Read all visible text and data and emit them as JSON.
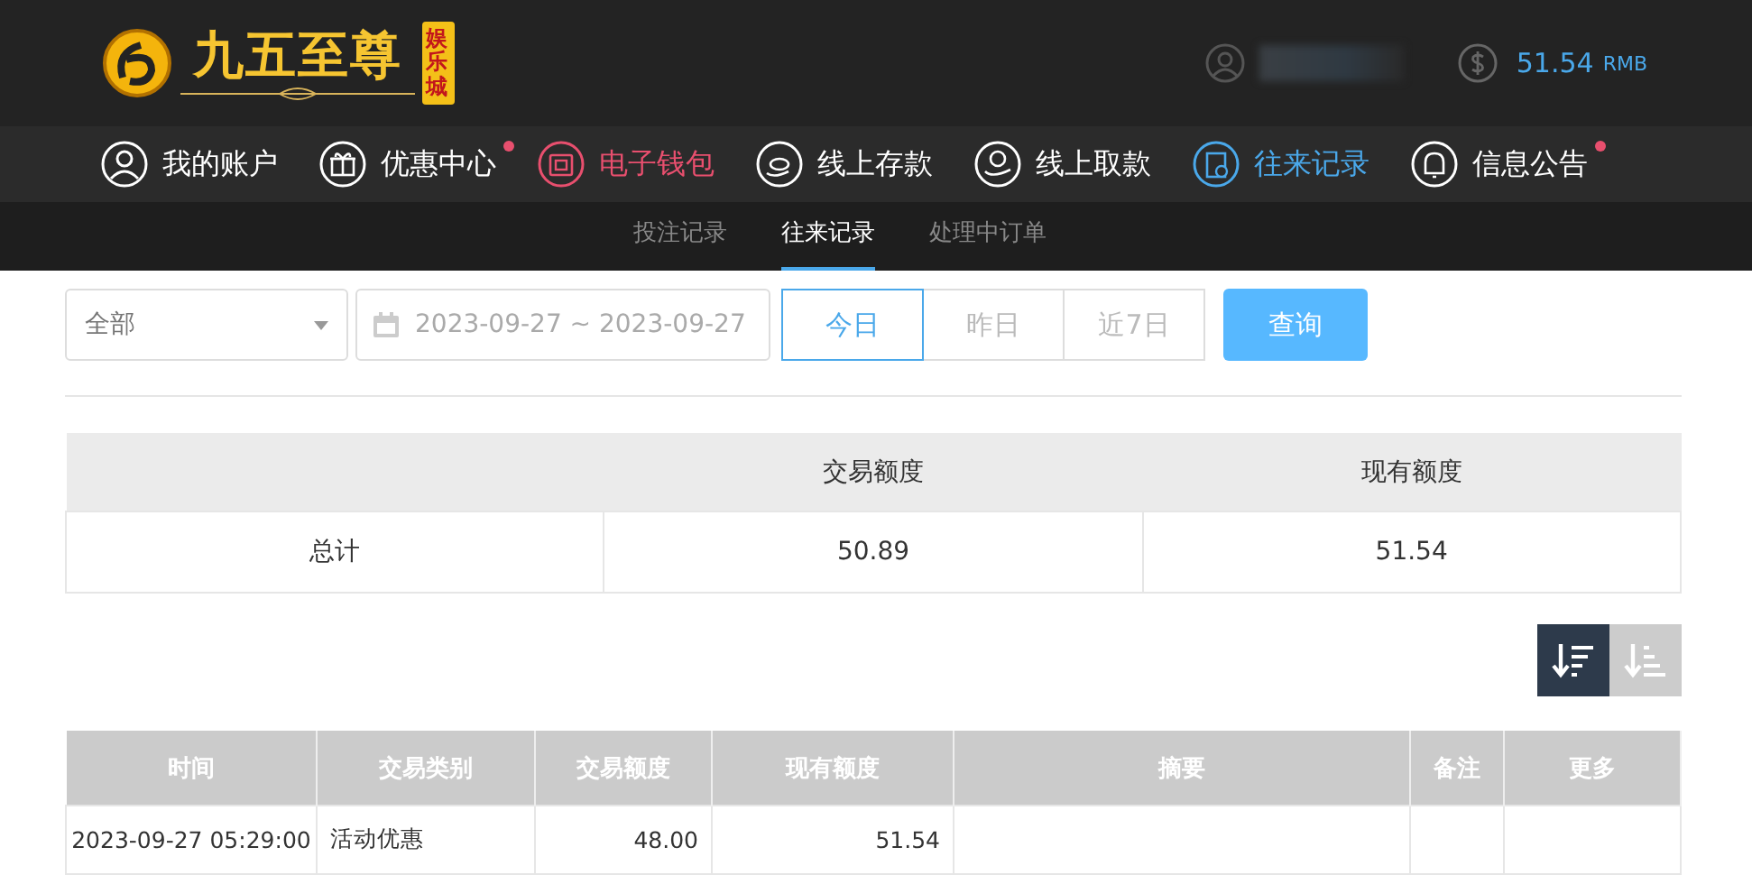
{
  "header": {
    "logo": {
      "name": "九五至尊",
      "badge": "娱乐城"
    },
    "balance": "51.54",
    "currency": "RMB"
  },
  "nav": [
    {
      "label": "我的账户",
      "kind": "user",
      "selected": false,
      "highlighted": false,
      "dot": false
    },
    {
      "label": "优惠中心",
      "kind": "gift",
      "selected": false,
      "highlighted": false,
      "dot": true
    },
    {
      "label": "电子钱包",
      "kind": "wallet",
      "selected": false,
      "highlighted": true,
      "dot": false
    },
    {
      "label": "线上存款",
      "kind": "deposit",
      "selected": false,
      "highlighted": false,
      "dot": false
    },
    {
      "label": "线上取款",
      "kind": "withdraw",
      "selected": false,
      "highlighted": false,
      "dot": false
    },
    {
      "label": "往来记录",
      "kind": "record",
      "selected": true,
      "highlighted": false,
      "dot": false
    },
    {
      "label": "信息公告",
      "kind": "bell",
      "selected": false,
      "highlighted": false,
      "dot": true
    }
  ],
  "subtabs": [
    {
      "label": "投注记录",
      "selected": false
    },
    {
      "label": "往来记录",
      "selected": true
    },
    {
      "label": "处理中订单",
      "selected": false
    }
  ],
  "filter": {
    "type": "全部",
    "date_range": "2023-09-27 ~ 2023-09-27",
    "ranges": [
      {
        "label": "今日",
        "selected": true
      },
      {
        "label": "昨日",
        "selected": false
      },
      {
        "label": "近7日",
        "selected": false
      }
    ],
    "query_button": "查询"
  },
  "summary": {
    "columns": [
      "交易额度",
      "现有额度"
    ],
    "row": {
      "label": "总计",
      "values": [
        "50.89",
        "51.54"
      ]
    }
  },
  "sort_buttons": [
    {
      "selected": true
    },
    {
      "selected": false
    }
  ],
  "table": {
    "columns": [
      "时间",
      "交易类别",
      "交易额度",
      "现有额度",
      "摘要",
      "备注",
      "更多"
    ],
    "rows": [
      [
        "2023-09-27 05:29:00",
        "活动优惠",
        "48.00",
        "51.54",
        "",
        "",
        ""
      ]
    ]
  }
}
